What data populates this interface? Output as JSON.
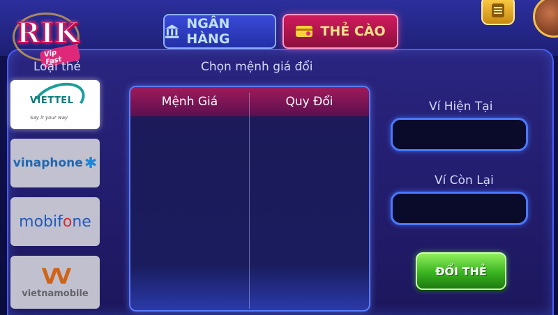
{
  "logo": {
    "main": "RIK",
    "sub": "Vip Fast"
  },
  "tabs": [
    {
      "label": "NGÂN HÀNG",
      "icon": "bank-icon",
      "active": false
    },
    {
      "label": "THẺ CÀO",
      "icon": "card-icon",
      "active": true
    }
  ],
  "card_type": {
    "label": "Loại thẻ",
    "providers": [
      {
        "name": "VIETTEL",
        "slogan": "Say it your way",
        "selected": true
      },
      {
        "name": "vinaphone",
        "selected": false
      },
      {
        "name": "mobifone",
        "selected": false
      },
      {
        "name": "vietnamobile",
        "mark": "VV",
        "selected": false
      }
    ]
  },
  "denomination": {
    "label": "Chọn mệnh giá đổi",
    "columns": [
      "Mệnh Giá",
      "Quy Đổi"
    ],
    "rows": []
  },
  "wallet": {
    "current_label": "Ví Hiện Tại",
    "current_value": "",
    "remaining_label": "Ví Còn Lại",
    "remaining_value": ""
  },
  "action": {
    "exchange_label": "ĐỔI THẺ"
  },
  "colors": {
    "active_tab": "#d11a5e",
    "inactive_tab": "#2330a6",
    "button": "#39b320",
    "panel_border": "#4a5cff"
  }
}
